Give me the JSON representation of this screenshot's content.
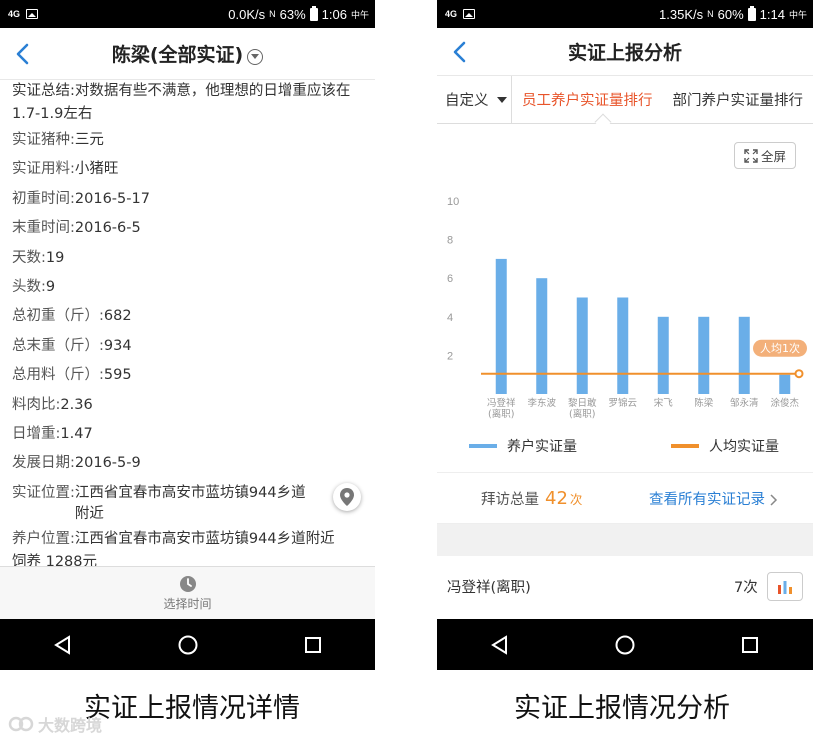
{
  "left_screen": {
    "status": {
      "signal": "4G",
      "speed": "0.0K/s",
      "nfc": "N",
      "battery": "63%",
      "time": "1:06",
      "ampm": "中午"
    },
    "title": "陈梁(全部实证)",
    "summary": "实证总结:对数据有些不满意，他理想的日增重应该在1.7-1.9左右",
    "rows": [
      {
        "k": "实证猪种:",
        "v": "三元"
      },
      {
        "k": "实证用料:",
        "v": "小猪旺"
      },
      {
        "k": "初重时间:",
        "v": "2016-5-17"
      },
      {
        "k": "末重时间:",
        "v": "2016-6-5"
      },
      {
        "k": "天数:",
        "v": "19"
      },
      {
        "k": "头数:",
        "v": "9"
      },
      {
        "k": "总初重（斤）:",
        "v": "682"
      },
      {
        "k": "总末重（斤）:",
        "v": "934"
      },
      {
        "k": "总用料（斤）:",
        "v": "595"
      },
      {
        "k": "料肉比:",
        "v": "2.36"
      },
      {
        "k": "日增重:",
        "v": "1.47"
      },
      {
        "k": "发展日期:",
        "v": "2016-5-9"
      }
    ],
    "location": {
      "k": "实证位置:",
      "v": "江西省宜春市高安市蓝坊镇944乡道附近"
    },
    "farm_location": {
      "k": "养户位置:",
      "v": "江西省宜春市高安市蓝坊镇944乡道附近"
    },
    "cut_row": "饲养 1288元",
    "bottom_label": "选择时间"
  },
  "right_screen": {
    "status": {
      "signal": "4G",
      "speed": "1.35K/s",
      "nfc": "N",
      "battery": "60%",
      "time": "1:14",
      "ampm": "中午"
    },
    "title": "实证上报分析",
    "tabs": {
      "custom": "自定义",
      "active": "员工养户实证量排行",
      "other": "部门养户实证量排行"
    },
    "fullscreen": "全屏",
    "avg_label": "人均1次",
    "legend": {
      "bar": "养户实证量",
      "line": "人均实证量"
    },
    "visits": {
      "label": "拜访总量",
      "num": "42",
      "unit": "次"
    },
    "view_all": "查看所有实证记录",
    "list": {
      "name": "冯登祥(离职)",
      "count": "7次"
    }
  },
  "chart_data": {
    "type": "bar",
    "categories": [
      "冯登祥(离职)",
      "李东波",
      "黎日敢(离职)",
      "罗锦云",
      "宋飞",
      "陈梁",
      "邹永清",
      "涂俊杰"
    ],
    "series": [
      {
        "name": "养户实证量",
        "type": "bar",
        "values": [
          7,
          6,
          5,
          5,
          4,
          4,
          4,
          1
        ],
        "color": "#6aaee8"
      },
      {
        "name": "人均实证量",
        "type": "line",
        "values": [
          1,
          1,
          1,
          1,
          1,
          1,
          1,
          1
        ],
        "color": "#f0902c"
      }
    ],
    "yticks": [
      2,
      4,
      6,
      8,
      10
    ],
    "ylim": [
      0,
      10
    ],
    "grid": false,
    "legend_position": "bottom"
  },
  "captions": {
    "left": "实证上报情况详情",
    "right": "实证上报情况分析"
  },
  "watermark": "大数跨境"
}
